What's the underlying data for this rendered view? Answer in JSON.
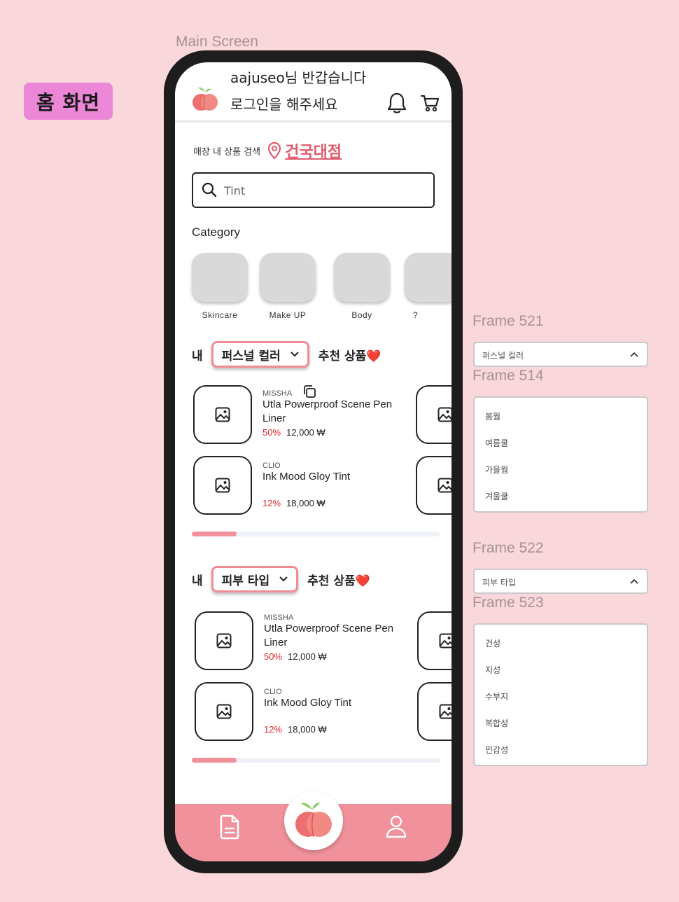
{
  "page_tag": "홈 화면",
  "frame_labels": {
    "main": "Main Screen",
    "f521": "Frame 521",
    "f514": "Frame 514",
    "f522": "Frame 522",
    "f523": "Frame 523"
  },
  "header": {
    "greeting": "aajuseo님 반갑습니다",
    "login_prompt": "로그인을 해주세요",
    "icons": [
      "peach-logo-icon",
      "bell-icon",
      "cart-icon"
    ]
  },
  "store": {
    "label": "매장 내 상품 검색",
    "name": "건국대점"
  },
  "search": {
    "placeholder": "Tint"
  },
  "category": {
    "title": "Category",
    "items": [
      "Skincare",
      "Make UP",
      "Body",
      "?"
    ]
  },
  "rec1": {
    "prefix": "내",
    "selected": "퍼스널 컬러",
    "suffix": "추천 상품❤️",
    "products": [
      {
        "brand": "MISSHA",
        "name": "Utla Powerproof Scene Pen Liner",
        "discount": "50%",
        "price": "12,000 ₩"
      },
      {
        "brand": "CLIO",
        "name": "Ink Mood Gloy Tint",
        "discount": "12%",
        "price": "18,000 ₩"
      }
    ],
    "scroll_progress": 0.18
  },
  "rec2": {
    "prefix": "내",
    "selected": "피부 타입",
    "suffix": "추천 상품❤️",
    "products": [
      {
        "brand": "MISSHA",
        "name": "Utla Powerproof Scene Pen Liner",
        "discount": "50%",
        "price": "12,000 ₩"
      },
      {
        "brand": "CLIO",
        "name": "Ink Mood Gloy Tint",
        "discount": "12%",
        "price": "18,000 ₩"
      }
    ],
    "scroll_progress": 0.18
  },
  "dropdown_personal_color": {
    "selected": "퍼스널 컬러",
    "options": [
      "봄웜",
      "여름쿨",
      "가을웜",
      "겨울쿨"
    ]
  },
  "dropdown_skin_type": {
    "selected": "피부 타입",
    "options": [
      "건성",
      "지성",
      "수부지",
      "복합성",
      "민감성"
    ]
  },
  "colors": {
    "background": "#f9d7da",
    "accent": "#f0919b",
    "store_link": "#e25b6c",
    "discount": "#e0262e",
    "tag": "#ec86d6"
  }
}
